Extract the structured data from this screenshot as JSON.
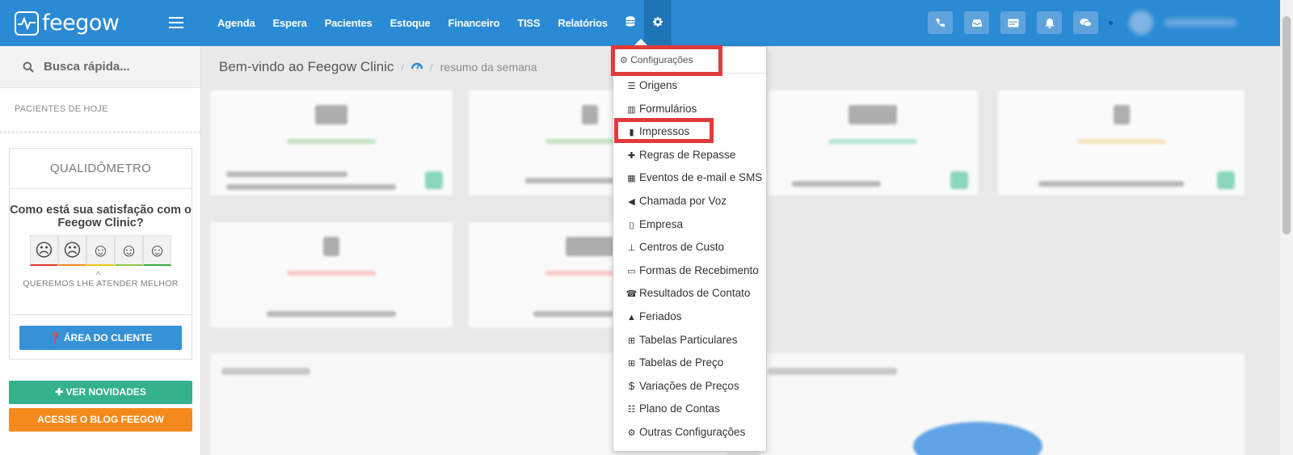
{
  "brand": {
    "name": "feegow"
  },
  "nav": {
    "items": [
      "Agenda",
      "Espera",
      "Pacientes",
      "Estoque",
      "Financeiro",
      "TISS",
      "Relatórios"
    ]
  },
  "topbar_icons": [
    "phone-icon",
    "inbox-icon",
    "card-icon",
    "bell-icon",
    "chat-icon"
  ],
  "search": {
    "label": "Busca rápida..."
  },
  "sidebar": {
    "section_label": "PACIENTES DE HOJE",
    "qualidometro": {
      "title": "QUALIDÔMETRO",
      "question": "Como está sua satisfação com o Feegow Clinic?",
      "faces": [
        "☹",
        "☹",
        "☺",
        "☺",
        "☺"
      ],
      "face_colors": [
        "#e0392b",
        "#f08a24",
        "#f2c51e",
        "#8bc34a",
        "#3caa45"
      ],
      "subtitle": "QUEREMOS LHE ATENDER MELHOR",
      "client_button": "ÁREA DO CLIENTE"
    },
    "news_button": "VER NOVIDADES",
    "blog_button": "ACESSE O BLOG FEEGOW"
  },
  "breadcrumb": {
    "title": "Bem-vindo ao Feegow Clinic",
    "current": "resumo da semana"
  },
  "dropdown": {
    "header": "Configurações",
    "items": [
      {
        "label": "Origens",
        "icon": "list-icon"
      },
      {
        "label": "Formulários",
        "icon": "chart-icon"
      },
      {
        "label": "Impressos",
        "icon": "file-icon"
      },
      {
        "label": "Regras de Repasse",
        "icon": "puzzle-icon"
      },
      {
        "label": "Eventos de e-mail e SMS",
        "icon": "calendar-icon"
      },
      {
        "label": "Chamada por Voz",
        "icon": "volume-icon"
      },
      {
        "label": "Empresa",
        "icon": "building-icon"
      },
      {
        "label": "Centros de Custo",
        "icon": "sitemap-icon"
      },
      {
        "label": "Formas de Recebimento",
        "icon": "credit-card-icon"
      },
      {
        "label": "Resultados de Contato",
        "icon": "phone-icon"
      },
      {
        "label": "Feriados",
        "icon": "road-icon"
      },
      {
        "label": "Tabelas Particulares",
        "icon": "table-icon"
      },
      {
        "label": "Tabelas de Preço",
        "icon": "table-icon"
      },
      {
        "label": "Variações de Preços",
        "icon": "dollar-icon"
      },
      {
        "label": "Plano de Contas",
        "icon": "list-alt-icon"
      },
      {
        "label": "Outras Configurações",
        "icon": "cogs-icon"
      }
    ]
  },
  "colors": {
    "primary": "#2a8ad3",
    "highlight": "#e13b3b",
    "success": "#33b28c",
    "warning": "#f48a1c"
  }
}
